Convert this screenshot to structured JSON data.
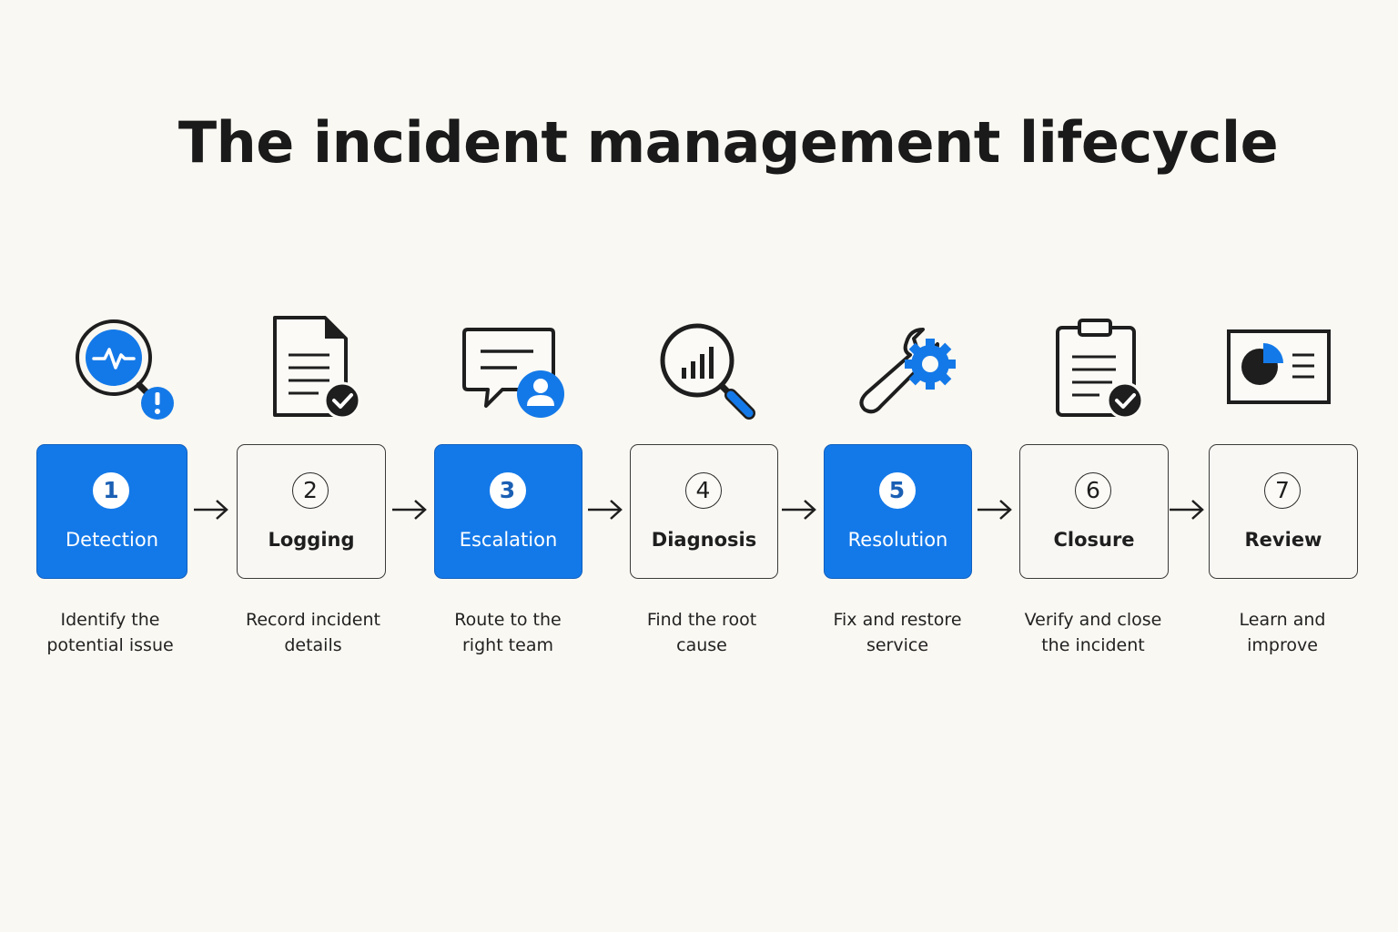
{
  "title": "The incident management lifecycle",
  "colors": {
    "accent": "#1479e8",
    "dark": "#1e1e1e",
    "background": "#faf8f2"
  },
  "steps": [
    {
      "number": "1",
      "label": "Detection",
      "description_line1": "Identify the",
      "description_line2": "potential issue",
      "icon": "magnifier-heartbeat-alert-icon",
      "highlighted": true
    },
    {
      "number": "2",
      "label": "Logging",
      "description_line1": "Record incident",
      "description_line2": "details",
      "icon": "document-check-icon",
      "highlighted": false
    },
    {
      "number": "3",
      "label": "Escalation",
      "description_line1": "Route to the",
      "description_line2": "right team",
      "icon": "chat-user-icon",
      "highlighted": true
    },
    {
      "number": "4",
      "label": "Diagnosis",
      "description_line1": "Find the root",
      "description_line2": "cause",
      "icon": "magnifier-chart-icon",
      "highlighted": false
    },
    {
      "number": "5",
      "label": "Resolution",
      "description_line1": "Fix and restore",
      "description_line2": "service",
      "icon": "wrench-gear-icon",
      "highlighted": true
    },
    {
      "number": "6",
      "label": "Closure",
      "description_line1": "Verify and close",
      "description_line2": "the incident",
      "icon": "clipboard-check-icon",
      "highlighted": false
    },
    {
      "number": "7",
      "label": "Review",
      "description_line1": "Learn and",
      "description_line2": "improve",
      "icon": "presentation-chart-icon",
      "highlighted": false
    }
  ]
}
